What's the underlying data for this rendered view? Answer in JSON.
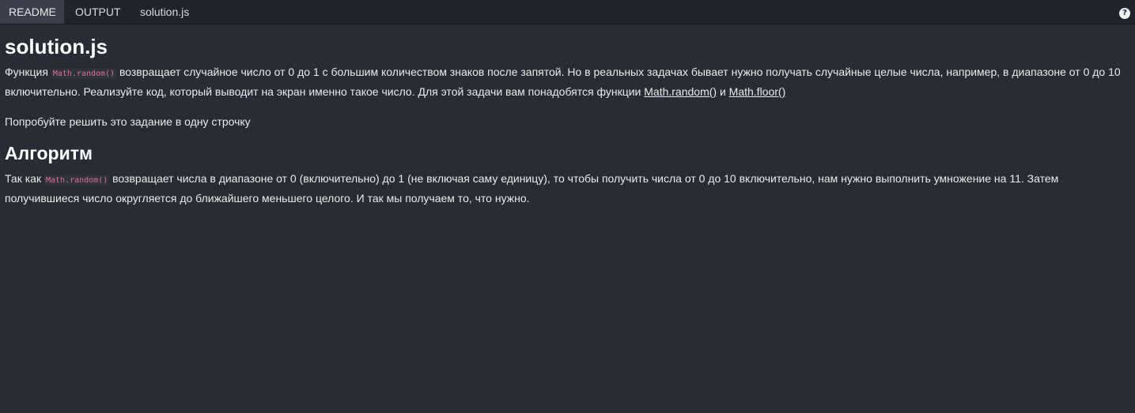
{
  "tabs": [
    {
      "label": "README",
      "active": true
    },
    {
      "label": "OUTPUT",
      "active": false
    },
    {
      "label": "solution.js",
      "active": false
    }
  ],
  "help": {
    "label": "?"
  },
  "readme": {
    "title": "solution.js",
    "p1": {
      "t1": "Функция ",
      "code": "Math.random()",
      "t2": " возвращает случайное число от 0 до 1 с большим количеством знаков после запятой. Но в реальных задачах бывает нужно получать случайные целые числа, например, в диапазоне от 0 до 10 включительно. Реализуйте код, который выводит на экран именно такое число. Для этой задачи вам понадобятся функции ",
      "link1": "Math.random()",
      "t3": " и ",
      "link2": "Math.floor()"
    },
    "p2": "Попробуйте решить это задание в одну строчку",
    "algorithm_heading": "Алгоритм",
    "p3": {
      "t1": "Так как ",
      "code": "Math.random()",
      "t2": " возвращает числа в диапазоне от 0 (включительно) до 1 (не включая саму единицу), то чтобы получить числа от 0 до 10 включительно, нам нужно выполнить умножение на 11. Затем получившиеся число округляется до ближайшего меньшего целого. И так мы получаем то, что нужно."
    }
  },
  "colors": {
    "background": "#282c34",
    "topbar": "#21252b",
    "active_tab": "#3a3f4b",
    "code_text": "#e06c9f"
  }
}
